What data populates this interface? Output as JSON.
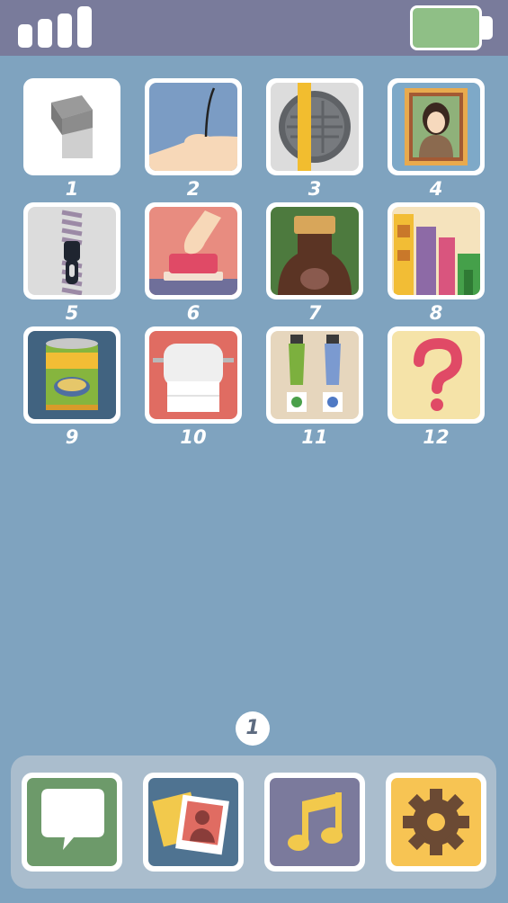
{
  "status_bar": {
    "signal_icon": "signal-bars-icon",
    "battery_icon": "battery-icon",
    "battery_color": "#8fbf86"
  },
  "levels": [
    {
      "number": "1",
      "icon": "light-switch-icon"
    },
    {
      "number": "2",
      "icon": "hair-strand-icon"
    },
    {
      "number": "3",
      "icon": "manhole-cover-icon"
    },
    {
      "number": "4",
      "icon": "portrait-painting-icon"
    },
    {
      "number": "5",
      "icon": "zipper-icon"
    },
    {
      "number": "6",
      "icon": "red-button-icon"
    },
    {
      "number": "7",
      "icon": "bottle-cork-icon"
    },
    {
      "number": "8",
      "icon": "books-icon"
    },
    {
      "number": "9",
      "icon": "soup-can-icon"
    },
    {
      "number": "10",
      "icon": "toilet-paper-icon"
    },
    {
      "number": "11",
      "icon": "paint-tubes-icon"
    },
    {
      "number": "12",
      "icon": "question-mark-icon"
    }
  ],
  "page_indicator": "1",
  "dock": [
    {
      "icon": "speech-bubble-icon",
      "color": "#6d9a6a"
    },
    {
      "icon": "photos-icon",
      "color": "#4f7391"
    },
    {
      "icon": "music-note-icon",
      "color": "#7b7a9c"
    },
    {
      "icon": "gear-icon",
      "color": "#f7c453"
    }
  ]
}
